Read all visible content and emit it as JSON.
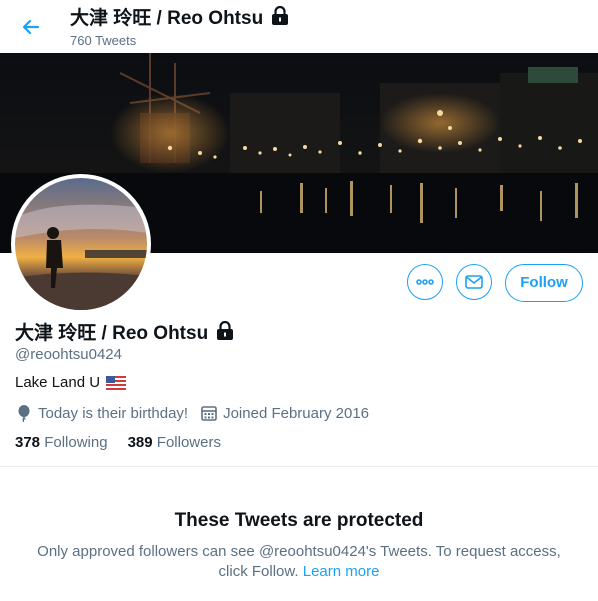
{
  "header": {
    "title": "大津 玲旺 / Reo Ohtsu",
    "tweet_count": "760 Tweets"
  },
  "profile": {
    "name": "大津 玲旺 / Reo Ohtsu",
    "handle": "@reoohtsu0424",
    "bio": "Lake Land U",
    "birthday": "Today is their birthday!",
    "joined": "Joined February 2016",
    "following_count": "378",
    "following_label": "Following",
    "followers_count": "389",
    "followers_label": "Followers"
  },
  "actions": {
    "follow_label": "Follow"
  },
  "protected": {
    "title": "These Tweets are protected",
    "text_prefix": "Only approved followers can see @reoohtsu0424's Tweets. To request access, click Follow. ",
    "learn_more": "Learn more"
  },
  "colors": {
    "accent": "#1da1f2",
    "secondary_text": "#5b7083",
    "primary_text": "#0f1419"
  },
  "icons": [
    "back-arrow-icon",
    "lock-icon",
    "more-icon",
    "mail-icon",
    "balloon-icon",
    "calendar-icon",
    "us-flag-icon"
  ]
}
